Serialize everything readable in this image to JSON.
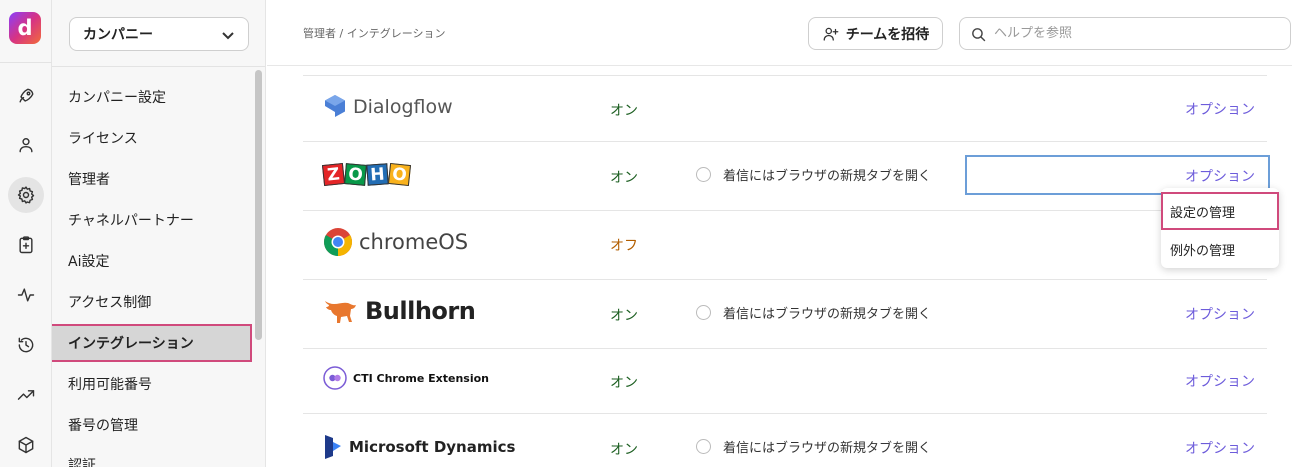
{
  "app": {
    "logo_letter": "d"
  },
  "sidebar": {
    "company_select": "カンパニー",
    "items": [
      {
        "label": "カンパニー設定"
      },
      {
        "label": "ライセンス"
      },
      {
        "label": "管理者"
      },
      {
        "label": "チャネルパートナー"
      },
      {
        "label": "Ai設定"
      },
      {
        "label": "アクセス制御"
      },
      {
        "label": "インテグレーション",
        "active": true
      },
      {
        "label": "利用可能番号"
      },
      {
        "label": "番号の管理"
      },
      {
        "label": "認証"
      }
    ]
  },
  "rail_icons": [
    "rocket-icon",
    "user-icon",
    "gear-icon",
    "clipboard-icon",
    "activity-icon",
    "history-icon",
    "trending-icon",
    "cube-icon"
  ],
  "header": {
    "breadcrumb": "管理者 / インテグレーション",
    "invite_label": "チームを招待",
    "search_placeholder": "ヘルプを参照"
  },
  "integrations": [
    {
      "name": "Dialogflow",
      "status": "オン",
      "option": "",
      "link": "オプション"
    },
    {
      "name": "ZOHO",
      "status": "オン",
      "option": "着信にはブラウザの新規タブを開く",
      "link": "オプション"
    },
    {
      "name": "chromeOS",
      "status": "オフ",
      "option": "",
      "link": ""
    },
    {
      "name": "Bullhorn",
      "status": "オン",
      "option": "着信にはブラウザの新規タブを開く",
      "link": "オプション"
    },
    {
      "name": "CTI Chrome Extension",
      "status": "オン",
      "option": "",
      "link": "オプション"
    },
    {
      "name": "Microsoft Dynamics",
      "status": "オン",
      "option": "着信にはブラウザの新規タブを開く",
      "link": "オプション"
    }
  ],
  "dropdown": {
    "items": [
      "設定の管理",
      "例外の管理"
    ]
  },
  "colors": {
    "accent_link": "#6d5cdb",
    "highlight": "#d04a7c",
    "status_on": "#1b5e20",
    "status_off": "#b25e00"
  }
}
